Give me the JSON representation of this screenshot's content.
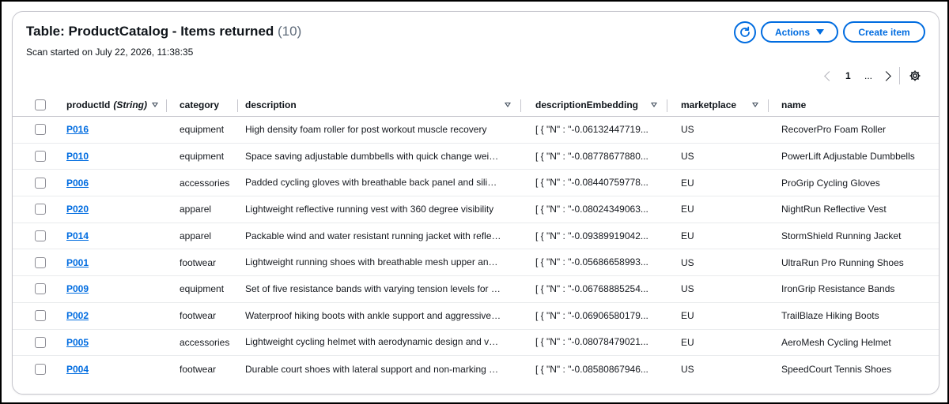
{
  "header": {
    "title": "Table: ProductCatalog - Items returned",
    "count": "(10)",
    "subtitle": "Scan started on July 22, 2026, 11:38:35",
    "actions_label": "Actions",
    "create_label": "Create item",
    "refresh_icon": "refresh-icon"
  },
  "pagination": {
    "current_page": "1",
    "ellipsis": "...",
    "prev_icon": "chevron-left-icon",
    "next_icon": "chevron-right-icon",
    "settings_icon": "gear-icon"
  },
  "columns": {
    "productId": "productId",
    "productId_type": "(String)",
    "category": "category",
    "description": "description",
    "descriptionEmbedding": "descriptionEmbedding",
    "marketplace": "marketplace",
    "name": "name"
  },
  "rows": [
    {
      "productId": "P016",
      "category": "equipment",
      "description": "High density foam roller for post workout muscle recovery",
      "descriptionEmbedding": "[ { \"N\" : \"-0.06132447719...",
      "marketplace": "US",
      "name": "RecoverPro Foam Roller"
    },
    {
      "productId": "P010",
      "category": "equipment",
      "description": "Space saving adjustable dumbbells with quick change weights",
      "descriptionEmbedding": "[ { \"N\" : \"-0.08778677880...",
      "marketplace": "US",
      "name": "PowerLift Adjustable Dumbbells"
    },
    {
      "productId": "P006",
      "category": "accessories",
      "description": "Padded cycling gloves with breathable back panel and silicone grip",
      "descriptionEmbedding": "[ { \"N\" : \"-0.08440759778...",
      "marketplace": "EU",
      "name": "ProGrip Cycling Gloves"
    },
    {
      "productId": "P020",
      "category": "apparel",
      "description": "Lightweight reflective running vest with 360 degree visibility",
      "descriptionEmbedding": "[ { \"N\" : \"-0.08024349063...",
      "marketplace": "EU",
      "name": "NightRun Reflective Vest"
    },
    {
      "productId": "P014",
      "category": "apparel",
      "description": "Packable wind and water resistant running jacket with reflective trim",
      "descriptionEmbedding": "[ { \"N\" : \"-0.09389919042...",
      "marketplace": "EU",
      "name": "StormShield Running Jacket"
    },
    {
      "productId": "P001",
      "category": "footwear",
      "description": "Lightweight running shoes with breathable mesh upper and cushioned sole",
      "descriptionEmbedding": "[ { \"N\" : \"-0.05686658993...",
      "marketplace": "US",
      "name": "UltraRun Pro Running Shoes"
    },
    {
      "productId": "P009",
      "category": "equipment",
      "description": "Set of five resistance bands with varying tension levels for training",
      "descriptionEmbedding": "[ { \"N\" : \"-0.06768885254...",
      "marketplace": "US",
      "name": "IronGrip Resistance Bands"
    },
    {
      "productId": "P002",
      "category": "footwear",
      "description": "Waterproof hiking boots with ankle support and aggressive tread",
      "descriptionEmbedding": "[ { \"N\" : \"-0.06906580179...",
      "marketplace": "EU",
      "name": "TrailBlaze Hiking Boots"
    },
    {
      "productId": "P005",
      "category": "accessories",
      "description": "Lightweight cycling helmet with aerodynamic design and ventilation",
      "descriptionEmbedding": "[ { \"N\" : \"-0.08078479021...",
      "marketplace": "EU",
      "name": "AeroMesh Cycling Helmet"
    },
    {
      "productId": "P004",
      "category": "footwear",
      "description": "Durable court shoes with lateral support and non-marking soles",
      "descriptionEmbedding": "[ { \"N\" : \"-0.08580867946...",
      "marketplace": "US",
      "name": "SpeedCourt Tennis Shoes"
    }
  ]
}
